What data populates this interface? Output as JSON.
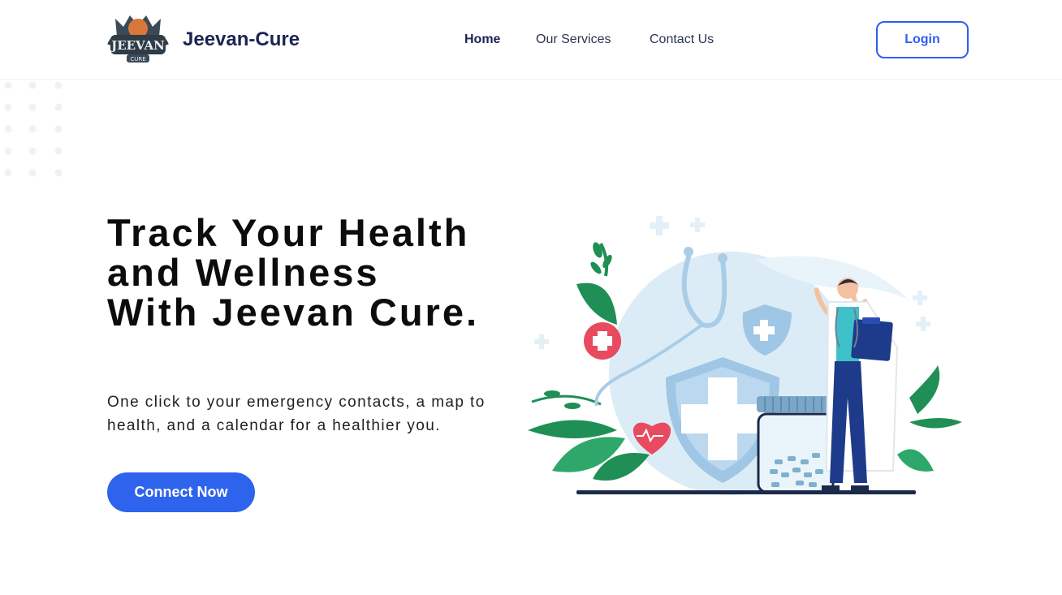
{
  "navbar": {
    "logo_text": "JEEVAN",
    "logo_subtext": "CURE",
    "brand_name": "Jeevan-Cure",
    "links": [
      {
        "label": "Home",
        "active": true
      },
      {
        "label": "Our Services",
        "active": false
      },
      {
        "label": "Contact Us",
        "active": false
      }
    ],
    "login_label": "Login"
  },
  "hero": {
    "headline": "Track Your Health and Wellness With Jeevan Cure.",
    "subtext": "One click to your emergency contacts, a map to health, and a calendar for a healthier you.",
    "cta_label": "Connect Now"
  },
  "colors": {
    "brand_navy": "#1c2452",
    "accent_blue": "#2e63ee",
    "illustration_light_blue": "#cfe6f3",
    "leaf_green": "#1f8f55",
    "cross_red": "#e84a5f",
    "doctor_navy": "#1e3a8a"
  },
  "icons": {
    "logo": "jeevan-cure-logo-badge",
    "illustration": "doctor-health-care-illustration"
  }
}
